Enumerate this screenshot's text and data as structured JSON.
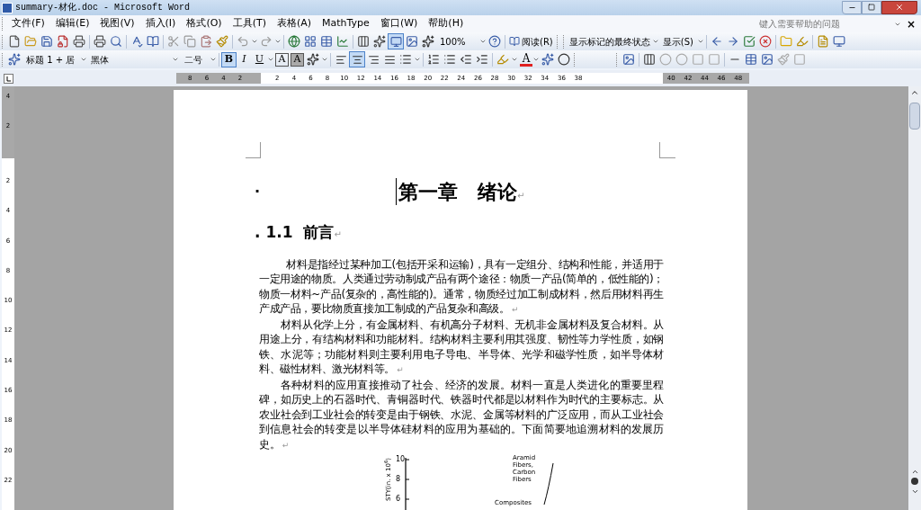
{
  "window": {
    "title": "summary-材化.doc - Microsoft Word"
  },
  "menu": [
    "文件(F)",
    "编辑(E)",
    "视图(V)",
    "插入(I)",
    "格式(O)",
    "工具(T)",
    "表格(A)",
    "MathType",
    "窗口(W)",
    "帮助(H)"
  ],
  "help_box": {
    "placeholder": "键入需要帮助的问题",
    "close": "×"
  },
  "standard_toolbar": {
    "zoom": "100%",
    "read_button": "阅读(R)",
    "markup_view": "显示标记的最终状态",
    "show_button": "显示(S)",
    "web_layout_selected": true
  },
  "formatting_toolbar": {
    "style": "标题 1 + 居",
    "font": "黑体",
    "size": "二号",
    "style_buttons": [
      {
        "label": "B",
        "selected": true
      },
      {
        "label": "I",
        "selected": false
      },
      {
        "label": "U",
        "selected": false
      }
    ],
    "char_buttons": [
      "A",
      "A"
    ],
    "alignments": [
      {
        "kind": "left",
        "selected": false
      },
      {
        "kind": "center",
        "selected": true
      },
      {
        "kind": "right",
        "selected": false
      },
      {
        "kind": "distributed",
        "selected": false
      }
    ],
    "font_color": "A"
  },
  "ruler": {
    "left_numbers": [
      "8",
      "6",
      "4",
      "2"
    ],
    "numbers": [
      "2",
      "4",
      "6",
      "8",
      "10",
      "12",
      "14",
      "16",
      "18",
      "20",
      "22",
      "24",
      "26",
      "28",
      "30",
      "32",
      "34",
      "36",
      "38"
    ],
    "right_numbers": [
      "40",
      "42",
      "44",
      "46",
      "48"
    ]
  },
  "vertical_ruler": {
    "top_numbers": [
      "4",
      "2"
    ],
    "numbers": [
      "2",
      "4",
      "6",
      "8",
      "10",
      "12",
      "14",
      "16",
      "18",
      "20",
      "22"
    ]
  },
  "document": {
    "chapter": {
      "marker": "·",
      "title": "第一章　绪论",
      "mark": "↵"
    },
    "section": {
      "marker": ".",
      "title": "1.1  前言",
      "mark": "↵"
    },
    "paragraphs": [
      {
        "text": "材料是指经过某种加工(包括开采和运输)，具有一定组分、结构和性能，并适用于一定用途的物质。人类通过劳动制成产品有两个途径：物质一产品(简单的，低性能的)；物质一材料~产品(复杂的，高性能的)。通常，物质经过加工制成材料，然后用材料再生产成产品，要比物质直接加工制成的产品复杂和高级。",
        "mark": "↵"
      },
      {
        "text": "材料从化学上分，有金属材料、有机高分子材料、无机非金属材料及复合材料。从用途上分，有结构材料和功能材料。结构材料主要利用其强度、韧性等力学性质，如钢铁、水泥等；功能材料则主要利用电子导电、半导体、光学和磁学性质，如半导体材料、磁性材料、激光材料等。",
        "mark": "↵"
      },
      {
        "text": "各种材料的应用直接推动了社会、经济的发展。材料一直是人类进化的重要里程碑，如历史上的石器时代、青铜器时代、铁器时代都是以材料作为时代的主要标志。从农业社会到工业社会的转变是由于钢铁、水泥、金属等材料的广泛应用，而从工业社会到信息社会的转变是以半导体硅材料的应用为基础的。下面简要地追溯材料的发展历史。",
        "mark": "↵"
      }
    ],
    "figure": {
      "ylabel": "STY(in. x 10$^{6}$)",
      "yticks": [
        "10",
        "8",
        "6"
      ],
      "labels": [
        "Aramid Fibers, Carbon Fibers",
        "Composites"
      ]
    }
  }
}
